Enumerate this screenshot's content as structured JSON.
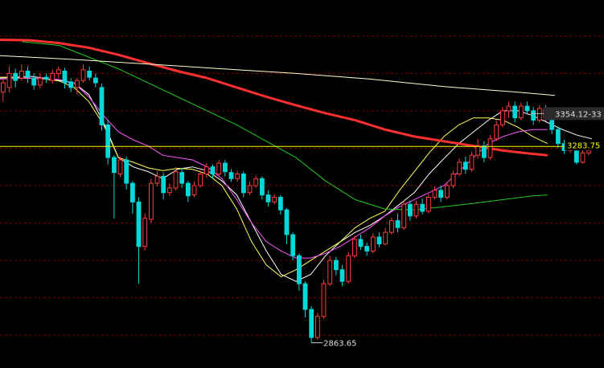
{
  "colors": {
    "background": "#000000",
    "grid": "#7a0000",
    "up": "#ff3b3b",
    "down": "#00d8d8",
    "ma5": "#ffffff",
    "ma10": "#ffff55",
    "ma20": "#ff55ff",
    "ma60": "#22cc22",
    "ma120": "#ff3030",
    "ma250": "#ffffcc",
    "ref_line": "#ffff00",
    "label_box": "#2a2a2a"
  },
  "chart_data": {
    "type": "candlestick",
    "ylim": [
      2820,
      3580
    ],
    "grid": true,
    "horizontal_grid_values": [
      3520,
      3440,
      3360,
      3280,
      3200,
      3120,
      3040,
      2960,
      2880
    ],
    "reference_line": {
      "value": 3283.75,
      "label": "3283.75"
    },
    "price_tag": {
      "value": 3354.12,
      "label": "3354.12-33"
    },
    "low_marker": {
      "value": 2863.65,
      "label": "2863.65"
    },
    "moving_averages": [
      {
        "key": "ma5",
        "color": "#ffffff",
        "points": [
          [
            0,
            3430
          ],
          [
            10,
            3432
          ],
          [
            20,
            3434
          ],
          [
            30,
            3430
          ],
          [
            40,
            3425
          ],
          [
            50,
            3420
          ],
          [
            60,
            3395
          ],
          [
            70,
            3335
          ],
          [
            80,
            3260
          ],
          [
            90,
            3240
          ],
          [
            100,
            3230
          ],
          [
            110,
            3215
          ],
          [
            120,
            3235
          ],
          [
            130,
            3240
          ],
          [
            140,
            3232
          ],
          [
            150,
            3210
          ],
          [
            160,
            3180
          ],
          [
            170,
            3120
          ],
          [
            180,
            3060
          ],
          [
            190,
            3010
          ],
          [
            200,
            2995
          ],
          [
            210,
            3010
          ],
          [
            220,
            3050
          ],
          [
            230,
            3080
          ],
          [
            240,
            3100
          ],
          [
            250,
            3115
          ],
          [
            260,
            3135
          ],
          [
            270,
            3160
          ],
          [
            280,
            3185
          ],
          [
            290,
            3225
          ],
          [
            300,
            3258
          ],
          [
            310,
            3290
          ],
          [
            320,
            3315
          ],
          [
            330,
            3340
          ],
          [
            340,
            3360
          ],
          [
            350,
            3360
          ],
          [
            360,
            3350
          ],
          [
            370,
            3335
          ],
          [
            380,
            3320
          ],
          [
            390,
            3308
          ],
          [
            400,
            3300
          ]
        ]
      },
      {
        "key": "ma10",
        "color": "#ffff55",
        "points": [
          [
            0,
            3432
          ],
          [
            10,
            3432
          ],
          [
            20,
            3430
          ],
          [
            30,
            3428
          ],
          [
            40,
            3424
          ],
          [
            50,
            3410
          ],
          [
            60,
            3380
          ],
          [
            70,
            3330
          ],
          [
            80,
            3260
          ],
          [
            90,
            3250
          ],
          [
            100,
            3238
          ],
          [
            110,
            3232
          ],
          [
            120,
            3237
          ],
          [
            130,
            3235
          ],
          [
            140,
            3225
          ],
          [
            150,
            3200
          ],
          [
            160,
            3150
          ],
          [
            170,
            3080
          ],
          [
            180,
            3030
          ],
          [
            190,
            3005
          ],
          [
            200,
            3020
          ],
          [
            210,
            3040
          ],
          [
            220,
            3060
          ],
          [
            230,
            3080
          ],
          [
            240,
            3110
          ],
          [
            250,
            3130
          ],
          [
            260,
            3145
          ],
          [
            270,
            3190
          ],
          [
            280,
            3230
          ],
          [
            290,
            3270
          ],
          [
            300,
            3305
          ],
          [
            310,
            3330
          ],
          [
            320,
            3345
          ],
          [
            330,
            3345
          ],
          [
            340,
            3340
          ],
          [
            350,
            3325
          ],
          [
            360,
            3305
          ],
          [
            370,
            3290
          ]
        ]
      },
      {
        "key": "ma20",
        "color": "#ff55ff",
        "points": [
          [
            0,
            3428
          ],
          [
            20,
            3430
          ],
          [
            40,
            3427
          ],
          [
            50,
            3420
          ],
          [
            60,
            3390
          ],
          [
            70,
            3350
          ],
          [
            80,
            3315
          ],
          [
            90,
            3298
          ],
          [
            100,
            3285
          ],
          [
            110,
            3265
          ],
          [
            120,
            3260
          ],
          [
            130,
            3255
          ],
          [
            140,
            3240
          ],
          [
            150,
            3215
          ],
          [
            160,
            3170
          ],
          [
            170,
            3120
          ],
          [
            180,
            3080
          ],
          [
            190,
            3060
          ],
          [
            200,
            3045
          ],
          [
            210,
            3045
          ],
          [
            220,
            3055
          ],
          [
            230,
            3070
          ],
          [
            240,
            3090
          ],
          [
            250,
            3110
          ],
          [
            260,
            3135
          ],
          [
            270,
            3155
          ],
          [
            280,
            3170
          ],
          [
            290,
            3185
          ],
          [
            300,
            3200
          ],
          [
            310,
            3230
          ],
          [
            320,
            3260
          ],
          [
            330,
            3290
          ],
          [
            340,
            3305
          ],
          [
            350,
            3315
          ],
          [
            360,
            3320
          ],
          [
            370,
            3320
          ]
        ]
      },
      {
        "key": "ma60",
        "color": "#22cc22",
        "points": [
          [
            15,
            3508
          ],
          [
            40,
            3500
          ],
          [
            60,
            3475
          ],
          [
            80,
            3450
          ],
          [
            100,
            3420
          ],
          [
            120,
            3390
          ],
          [
            140,
            3360
          ],
          [
            160,
            3330
          ],
          [
            180,
            3295
          ],
          [
            200,
            3260
          ],
          [
            220,
            3210
          ],
          [
            240,
            3170
          ],
          [
            260,
            3150
          ],
          [
            280,
            3148
          ],
          [
            300,
            3155
          ],
          [
            320,
            3162
          ],
          [
            340,
            3170
          ],
          [
            360,
            3178
          ],
          [
            370,
            3180
          ]
        ]
      },
      {
        "key": "ma120",
        "color": "#ff3030",
        "points": [
          [
            0,
            3512
          ],
          [
            20,
            3511
          ],
          [
            40,
            3505
          ],
          [
            60,
            3495
          ],
          [
            80,
            3480
          ],
          [
            100,
            3462
          ],
          [
            120,
            3445
          ],
          [
            140,
            3430
          ],
          [
            160,
            3410
          ],
          [
            180,
            3390
          ],
          [
            200,
            3372
          ],
          [
            220,
            3355
          ],
          [
            240,
            3340
          ],
          [
            260,
            3320
          ],
          [
            280,
            3305
          ],
          [
            300,
            3295
          ],
          [
            320,
            3285
          ],
          [
            340,
            3275
          ],
          [
            360,
            3268
          ],
          [
            370,
            3265
          ]
        ]
      },
      {
        "key": "ma250",
        "color": "#ffffcc",
        "points": [
          [
            0,
            3478
          ],
          [
            50,
            3470
          ],
          [
            100,
            3460
          ],
          [
            150,
            3450
          ],
          [
            200,
            3440
          ],
          [
            250,
            3428
          ],
          [
            300,
            3412
          ],
          [
            350,
            3400
          ],
          [
            375,
            3393
          ]
        ]
      }
    ],
    "candles": [
      [
        3400,
        3420,
        3380,
        3430
      ],
      [
        3410,
        3440,
        3400,
        3455
      ],
      [
        3440,
        3425,
        3410,
        3450
      ],
      [
        3430,
        3445,
        3425,
        3460
      ],
      [
        3445,
        3432,
        3420,
        3455
      ],
      [
        3430,
        3415,
        3405,
        3440
      ],
      [
        3415,
        3430,
        3408,
        3440
      ],
      [
        3432,
        3428,
        3420,
        3440
      ],
      [
        3425,
        3440,
        3418,
        3448
      ],
      [
        3440,
        3448,
        3430,
        3455
      ],
      [
        3445,
        3420,
        3408,
        3452
      ],
      [
        3422,
        3410,
        3400,
        3430
      ],
      [
        3410,
        3425,
        3395,
        3430
      ],
      [
        3425,
        3448,
        3420,
        3460
      ],
      [
        3445,
        3432,
        3425,
        3455
      ],
      [
        3430,
        3420,
        3410,
        3440
      ],
      [
        3410,
        3330,
        3318,
        3418
      ],
      [
        3330,
        3260,
        3245,
        3340
      ],
      [
        3260,
        3228,
        3130,
        3265
      ],
      [
        3225,
        3255,
        3218,
        3262
      ],
      [
        3255,
        3205,
        3192,
        3262
      ],
      [
        3205,
        3165,
        3140,
        3210
      ],
      [
        3165,
        3070,
        2990,
        3175
      ],
      [
        3070,
        3130,
        3062,
        3140
      ],
      [
        3128,
        3205,
        3120,
        3215
      ],
      [
        3205,
        3220,
        3198,
        3230
      ],
      [
        3220,
        3185,
        3170,
        3228
      ],
      [
        3185,
        3195,
        3178,
        3205
      ],
      [
        3195,
        3230,
        3190,
        3240
      ],
      [
        3228,
        3205,
        3195,
        3238
      ],
      [
        3205,
        3178,
        3165,
        3210
      ],
      [
        3180,
        3200,
        3175,
        3208
      ],
      [
        3200,
        3225,
        3195,
        3232
      ],
      [
        3225,
        3240,
        3218,
        3248
      ],
      [
        3240,
        3225,
        3215,
        3245
      ],
      [
        3225,
        3248,
        3220,
        3255
      ],
      [
        3248,
        3230,
        3220,
        3255
      ],
      [
        3228,
        3215,
        3208,
        3235
      ],
      [
        3215,
        3225,
        3208,
        3232
      ],
      [
        3225,
        3185,
        3175,
        3230
      ],
      [
        3185,
        3200,
        3180,
        3208
      ],
      [
        3200,
        3215,
        3195,
        3222
      ],
      [
        3215,
        3180,
        3170,
        3220
      ],
      [
        3180,
        3165,
        3155,
        3190
      ],
      [
        3165,
        3175,
        3160,
        3182
      ],
      [
        3175,
        3148,
        3138,
        3180
      ],
      [
        3148,
        3095,
        3075,
        3152
      ],
      [
        3095,
        3050,
        3040,
        3100
      ],
      [
        3050,
        2990,
        2975,
        3055
      ],
      [
        2990,
        2935,
        2918,
        2995
      ],
      [
        2935,
        2875,
        2863.65,
        2942
      ],
      [
        2875,
        2920,
        2870,
        2928
      ],
      [
        2920,
        2990,
        2915,
        2998
      ],
      [
        2990,
        3040,
        2985,
        3050
      ],
      [
        3040,
        3020,
        3008,
        3048
      ],
      [
        3020,
        2995,
        2985,
        3030
      ],
      [
        2995,
        3050,
        2990,
        3058
      ],
      [
        3050,
        3085,
        3045,
        3092
      ],
      [
        3085,
        3070,
        3062,
        3095
      ],
      [
        3070,
        3060,
        3050,
        3078
      ],
      [
        3060,
        3090,
        3055,
        3098
      ],
      [
        3090,
        3075,
        3068,
        3100
      ],
      [
        3075,
        3100,
        3072,
        3110
      ],
      [
        3100,
        3125,
        3095,
        3132
      ],
      [
        3125,
        3110,
        3100,
        3140
      ],
      [
        3110,
        3160,
        3105,
        3168
      ],
      [
        3160,
        3135,
        3125,
        3168
      ],
      [
        3135,
        3160,
        3130,
        3168
      ],
      [
        3160,
        3145,
        3138,
        3172
      ],
      [
        3145,
        3175,
        3140,
        3182
      ],
      [
        3175,
        3190,
        3170,
        3198
      ],
      [
        3190,
        3175,
        3165,
        3200
      ],
      [
        3175,
        3200,
        3170,
        3208
      ],
      [
        3200,
        3225,
        3195,
        3232
      ],
      [
        3225,
        3250,
        3220,
        3258
      ],
      [
        3250,
        3235,
        3225,
        3262
      ],
      [
        3235,
        3265,
        3230,
        3272
      ],
      [
        3265,
        3285,
        3258,
        3300
      ],
      [
        3285,
        3260,
        3250,
        3295
      ],
      [
        3260,
        3300,
        3255,
        3308
      ],
      [
        3300,
        3330,
        3295,
        3340
      ],
      [
        3330,
        3360,
        3325,
        3368
      ],
      [
        3360,
        3370,
        3345,
        3380
      ],
      [
        3370,
        3345,
        3335,
        3380
      ],
      [
        3345,
        3370,
        3340,
        3378
      ],
      [
        3370,
        3360,
        3352,
        3380
      ],
      [
        3360,
        3340,
        3330,
        3368
      ],
      [
        3340,
        3365,
        3335,
        3372
      ],
      [
        3365,
        3345,
        3338,
        3372
      ],
      [
        3345,
        3320,
        3310,
        3352
      ],
      [
        3320,
        3290,
        3280,
        3325
      ],
      [
        3290,
        3275,
        3268,
        3298
      ],
      [
        3275,
        3280,
        3270,
        3290
      ],
      [
        3280,
        3250,
        3245,
        3285
      ],
      [
        3250,
        3270,
        3247,
        3278
      ],
      [
        3270,
        3275,
        3265,
        3282
      ]
    ]
  }
}
